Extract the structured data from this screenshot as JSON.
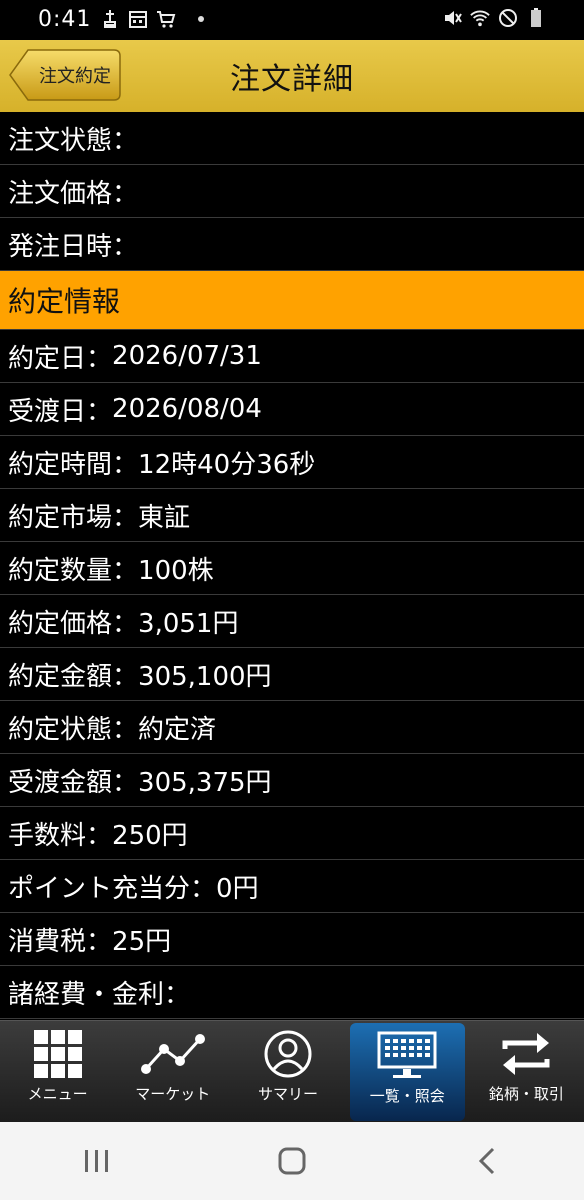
{
  "status_bar": {
    "time": "0:41",
    "left_icons": [
      "usb-icon",
      "calendar-icon",
      "cart-icon",
      "notification-dot"
    ],
    "right_icons": [
      "mute-icon",
      "wifi-icon",
      "do-not-disturb-icon",
      "battery-icon"
    ]
  },
  "header": {
    "back_label": "注文約定",
    "title": "注文詳細",
    "bg_color": "#e0be3a"
  },
  "order_rows": [
    {
      "label": "注文状態",
      "value": ""
    },
    {
      "label": "注文価格",
      "value": ""
    },
    {
      "label": "発注日時",
      "value": ""
    }
  ],
  "section": {
    "title": "約定情報",
    "color": "#ffa200"
  },
  "execution_rows": [
    {
      "label": "約定日",
      "value": "2026/07/31"
    },
    {
      "label": "受渡日",
      "value": "2026/08/04"
    },
    {
      "label": "約定時間",
      "value": "12時40分36秒"
    },
    {
      "label": "約定市場",
      "value": "東証"
    },
    {
      "label": "約定数量",
      "value": "100株"
    },
    {
      "label": "約定価格",
      "value": "3,051円"
    },
    {
      "label": "約定金額",
      "value": "305,100円"
    },
    {
      "label": "約定状態",
      "value": "約定済"
    },
    {
      "label": "受渡金額",
      "value": "305,375円"
    },
    {
      "label": "手数料",
      "value": "250円"
    },
    {
      "label": "ポイント充当分",
      "value": "0円"
    },
    {
      "label": "消費税",
      "value": "25円"
    },
    {
      "label": "諸経費・金利",
      "value": ""
    }
  ],
  "separator": "：",
  "tabs": [
    {
      "label": "メニュー",
      "icon": "grid-icon",
      "active": false
    },
    {
      "label": "マーケット",
      "icon": "chart-line-icon",
      "active": false
    },
    {
      "label": "サマリー",
      "icon": "user-circle-icon",
      "active": false
    },
    {
      "label": "一覧・照会",
      "icon": "monitor-keyboard-icon",
      "active": true
    },
    {
      "label": "銘柄・取引",
      "icon": "swap-arrows-icon",
      "active": false
    }
  ],
  "nav_bar": {
    "buttons": [
      "recent-apps-icon",
      "home-icon",
      "back-icon"
    ]
  }
}
